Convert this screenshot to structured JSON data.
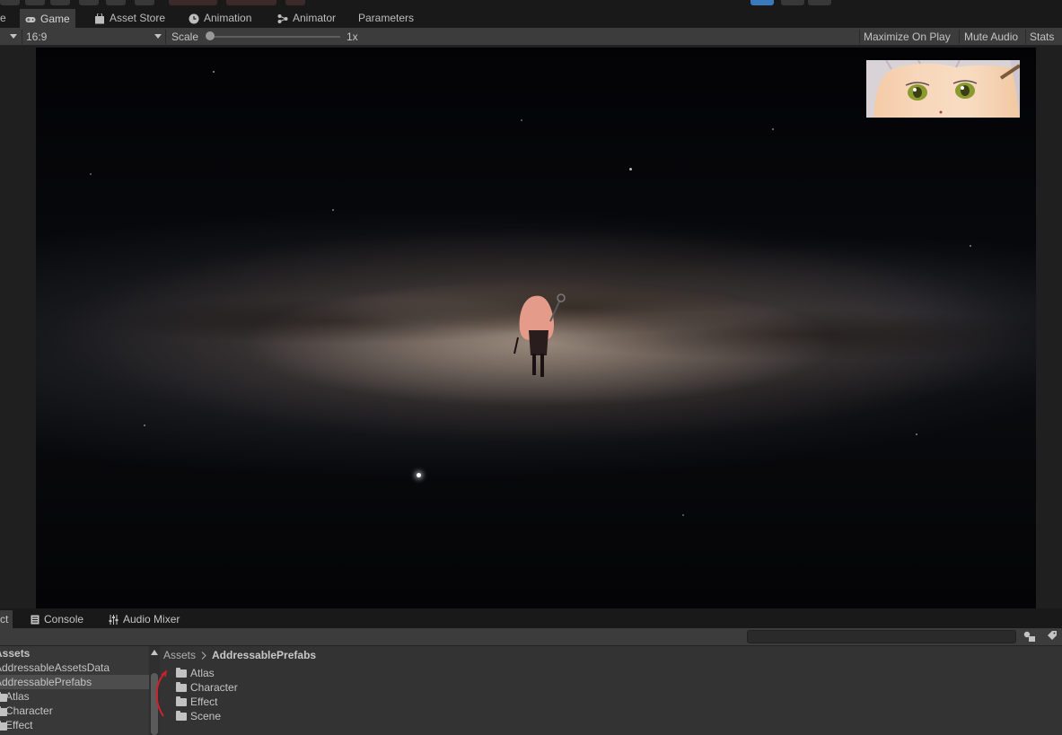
{
  "tabs": [
    {
      "label": "Game",
      "active": true
    },
    {
      "label": "Asset Store",
      "active": false
    },
    {
      "label": "Animation",
      "active": false
    },
    {
      "label": "Animator",
      "active": false
    },
    {
      "label": "Parameters",
      "active": false
    }
  ],
  "game_toolbar": {
    "aspect": "16:9",
    "scale_label": "Scale",
    "scale_value": "1x",
    "maximize_on_play": "Maximize On Play",
    "mute_audio": "Mute Audio",
    "stats": "Stats"
  },
  "bottom_tabs": [
    {
      "label": "Console"
    },
    {
      "label": "Audio Mixer"
    }
  ],
  "search": {
    "value": ""
  },
  "tree": {
    "root": "Assets",
    "items": [
      "AddressableAssetsData",
      "AddressablePrefabs",
      "Atlas",
      "Character",
      "Effect"
    ],
    "selected_index": 1
  },
  "breadcrumb": [
    "Assets",
    "AddressablePrefabs"
  ],
  "folders": [
    "Atlas",
    "Character",
    "Effect",
    "Scene"
  ],
  "colors": {
    "panel": "#3c3c3c",
    "dark": "#191919",
    "accent": "#3a79bb",
    "annotation": "#d0202a"
  }
}
